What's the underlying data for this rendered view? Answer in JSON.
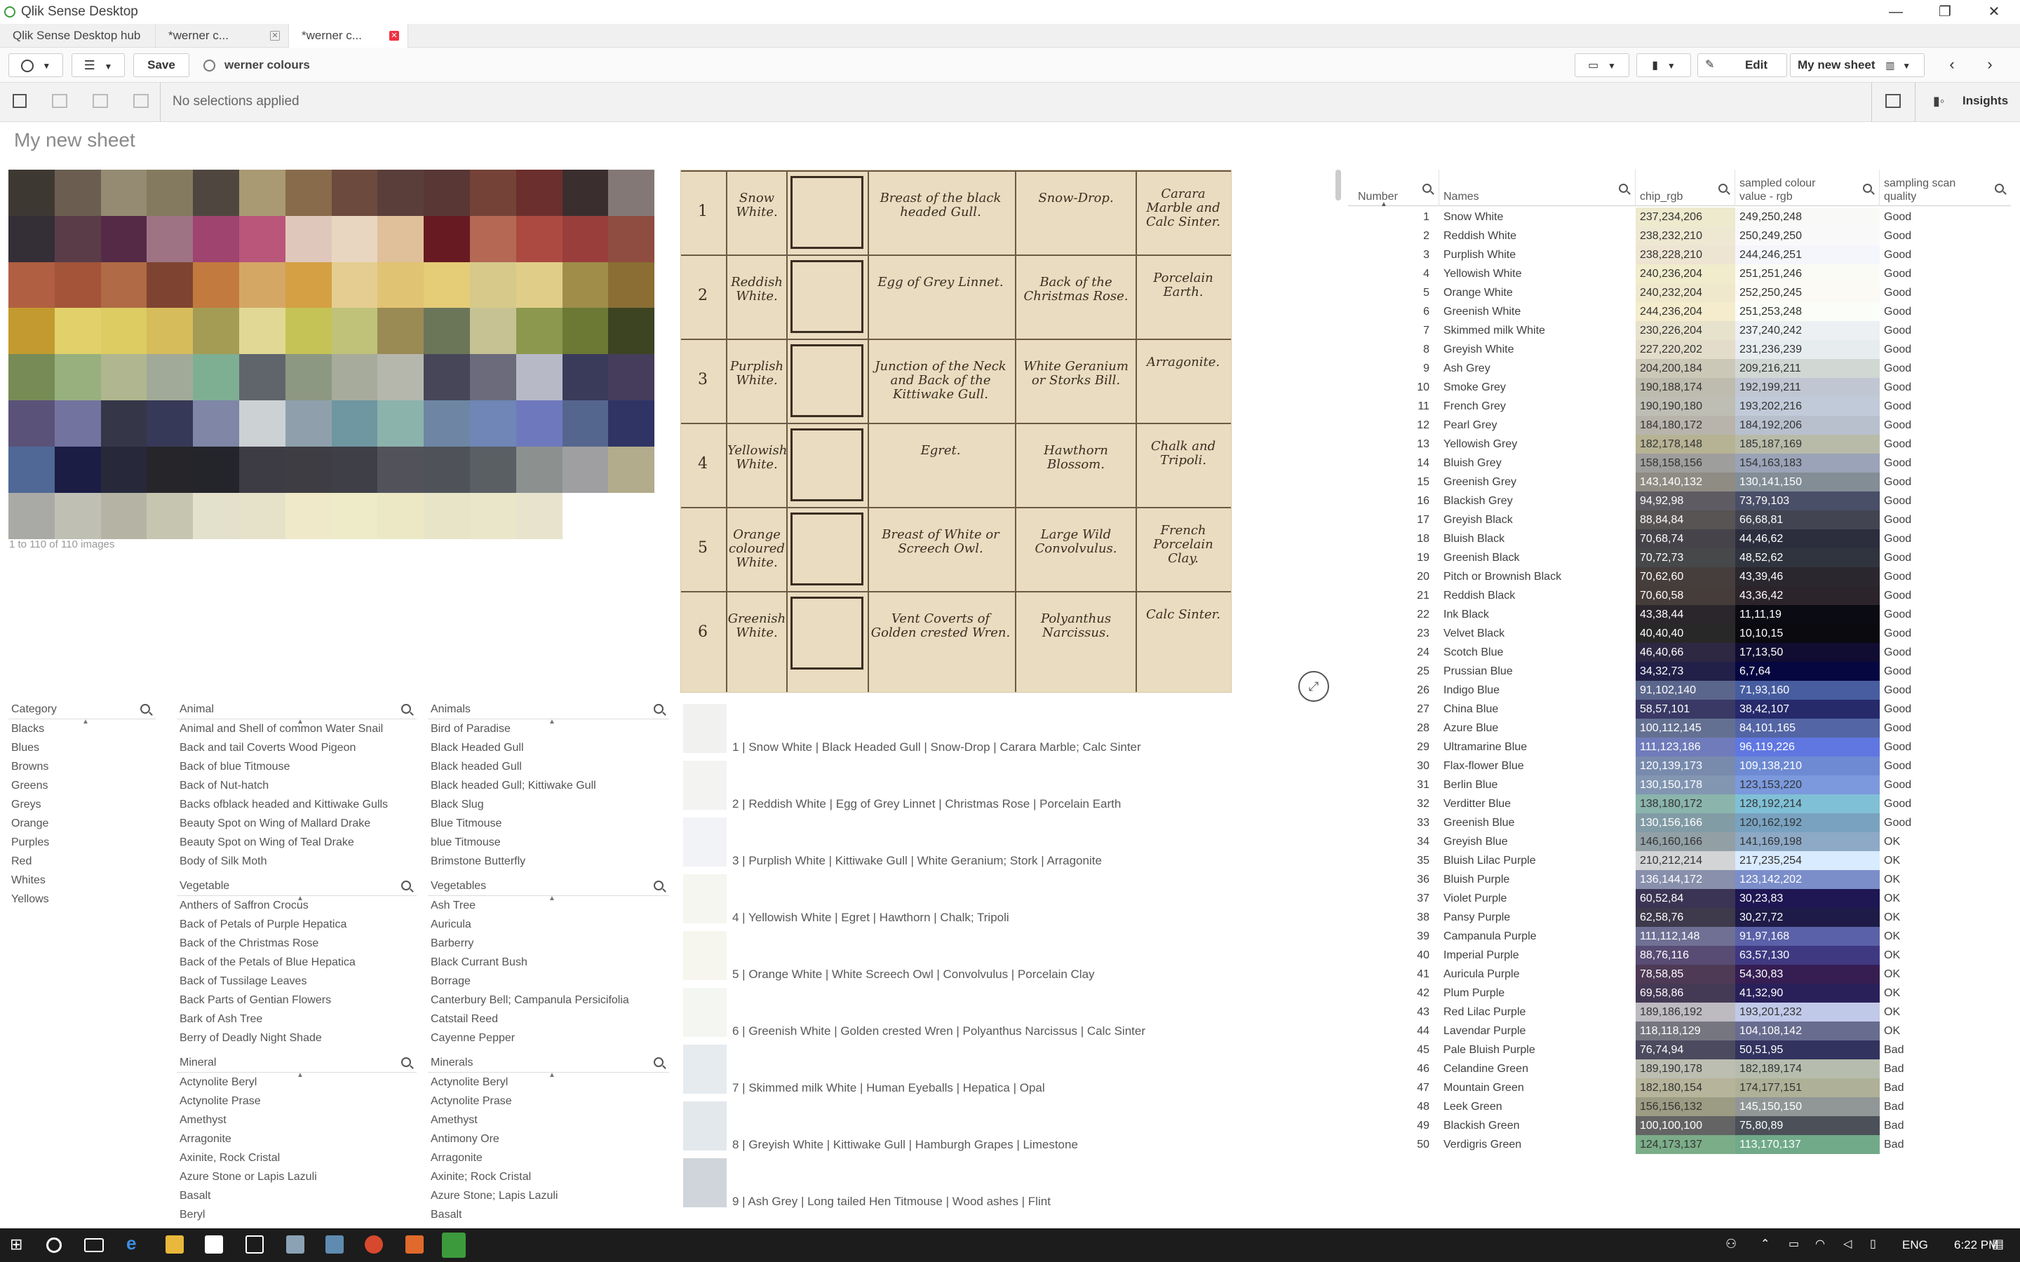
{
  "titlebar": {
    "title": "Qlik Sense Desktop",
    "minimize": "—",
    "maximize": "❐",
    "close": "✕"
  },
  "tabs": [
    {
      "label": "Qlik Sense Desktop hub",
      "close": ""
    },
    {
      "label": "*werner c...",
      "close": "✕"
    },
    {
      "label": "*werner c...",
      "close": "✕"
    }
  ],
  "toolbar": {
    "save_label": "Save",
    "app_name": "werner colours",
    "edit_label": "Edit",
    "sheet_label": "My new sheet"
  },
  "selection": {
    "status": "No selections applied",
    "insights_label": "Insights"
  },
  "sheet": {
    "title": "My new sheet",
    "image_count": "1 to 110 of 110 images"
  },
  "chip_colors": [
    "#3e3833",
    "#6b5e50",
    "#958a72",
    "#847a60",
    "#4f473f",
    "#a99a73",
    "#876b4b",
    "#6d4a3e",
    "#5a3e3a",
    "#583734",
    "#754238",
    "#6b2f2d",
    "#3b2e2e",
    "#847876",
    "#342e36",
    "#5a3c49",
    "#552a46",
    "#9e7384",
    "#9e446e",
    "#b9567a",
    "#e0c7bc",
    "#e9d6c0",
    "#e0c09a",
    "#681a22",
    "#b56854",
    "#ac4a42",
    "#9a3e3c",
    "#8f4c40",
    "#b15f42",
    "#a35439",
    "#b06a45",
    "#7e4431",
    "#c27a3f",
    "#d5a764",
    "#d4a043",
    "#e5cd91",
    "#e1c374",
    "#e5cc76",
    "#d6c98a",
    "#e0ce88",
    "#a08d4a",
    "#8b6e34",
    "#c39a2f",
    "#e2d06b",
    "#dccc62",
    "#d7bc5c",
    "#a49c54",
    "#e1d896",
    "#c5c356",
    "#bfc278",
    "#9a8a54",
    "#6b7659",
    "#c6c293",
    "#8c984e",
    "#6b7935",
    "#3c4422",
    "#768b56",
    "#97b07e",
    "#b0b68f",
    "#a1aa98",
    "#7faf93",
    "#60656b",
    "#8d9883",
    "#a7ab9b",
    "#b5b7ad",
    "#474658",
    "#6b6b7c",
    "#b8b9c7",
    "#3a3b5a",
    "#463d5c",
    "#5b5279",
    "#7373a0",
    "#353749",
    "#373958",
    "#7f86a6",
    "#ccd1d4",
    "#8fa0ac",
    "#6f97a1",
    "#8bb3ac",
    "#6e86a4",
    "#6f86b6",
    "#6e79bd",
    "#55668e",
    "#2f3465",
    "#4f6895",
    "#1b1d45",
    "#27283a",
    "#26262a",
    "#24252b",
    "#3d3c45",
    "#3e3d43",
    "#3f4047",
    "#52535a",
    "#4f5258",
    "#5a5f64",
    "#8c918f",
    "#9f9fa1",
    "#b2ab8c",
    "#a9aaa5",
    "#bfbfb4",
    "#b5b4a4",
    "#c6c5b0",
    "#e3e0cc",
    "#e6e1c9",
    "#efe9c9",
    "#eeebc9",
    "#ece7c5",
    "#e8e4c8",
    "#e9e6ca",
    "#e7e3cc"
  ],
  "plate": {
    "rows": [
      {
        "num": "1",
        "name": "Snow White.",
        "animal": "Breast of the black headed Gull.",
        "vegetable": "Snow-Drop.",
        "mineral": "Carara Marble and Calc Sinter."
      },
      {
        "num": "2",
        "name": "Reddish White.",
        "animal": "Egg of Grey Linnet.",
        "vegetable": "Back of the Christmas Rose.",
        "mineral": "Porcelain Earth."
      },
      {
        "num": "3",
        "name": "Purplish White.",
        "animal": "Junction of the Neck and Back of the Kittiwake Gull.",
        "vegetable": "White Geranium or Storks Bill.",
        "mineral": "Arragonite."
      },
      {
        "num": "4",
        "name": "Yellowish White.",
        "animal": "Egret.",
        "vegetable": "Hawthorn Blossom.",
        "mineral": "Chalk and Tripoli."
      },
      {
        "num": "5",
        "name": "Orange coloured White.",
        "animal": "Breast of White or Screech Owl.",
        "vegetable": "Large Wild Convolvulus.",
        "mineral": "French Porcelain Clay."
      },
      {
        "num": "6",
        "name": "Greenish White.",
        "animal": "Vent Coverts of Golden crested Wren.",
        "vegetable": "Polyanthus Narcissus.",
        "mineral": "Calc Sinter."
      }
    ]
  },
  "filters": {
    "category": {
      "title": "Category",
      "items": [
        "Blacks",
        "Blues",
        "Browns",
        "Greens",
        "Greys",
        "Orange",
        "Purples",
        "Red",
        "Whites",
        "Yellows"
      ]
    },
    "animal": {
      "title": "Animal",
      "items": [
        "Animal and Shell of common Water Snail",
        "Back and tail Coverts Wood Pigeon",
        "Back of blue Titmouse",
        "Back of Nut-hatch",
        "Backs ofblack headed and Kittiwake Gulls",
        "Beauty Spot on Wing of Mallard Drake",
        "Beauty Spot on Wing of Teal Drake",
        "Body of Silk Moth"
      ]
    },
    "animals": {
      "title": "Animals",
      "items": [
        "Bird of Paradise",
        "Black Headed Gull",
        "Black headed Gull",
        "Black headed Gull; Kittiwake Gull",
        "Black Slug",
        "Blue Titmouse",
        "blue Titmouse",
        "Brimstone Butterfly"
      ]
    },
    "vegetable": {
      "title": "Vegetable",
      "items": [
        "Anthers of Saffron Crocus",
        "Back of Petals of Purple Hepatica",
        "Back of the Christmas Rose",
        "Back of the Petals of Blue Hepatica",
        "Back of Tussilage Leaves",
        "Back Parts of Gentian Flowers",
        "Bark of Ash Tree",
        "Berry of Deadly Night Shade"
      ]
    },
    "vegetables": {
      "title": "Vegetables",
      "items": [
        "Ash Tree",
        "Auricula",
        "Barberry",
        "Black Currant Bush",
        "Borrage",
        "Canterbury Bell; Campanula Persicifolia",
        "Catstail Reed",
        "Cayenne Pepper"
      ]
    },
    "mineral": {
      "title": "Mineral",
      "items": [
        "Actynolite Beryl",
        "Actynolite Prase",
        "Amethyst",
        "Arragonite",
        "Axinite, Rock Cristal",
        "Azure Stone or Lapis Lazuli",
        "Basalt",
        "Beryl"
      ]
    },
    "minerals": {
      "title": "Minerals",
      "items": [
        "Actynolite Beryl",
        "Actynolite Prase",
        "Amethyst",
        "Antimony Ore",
        "Arragonite",
        "Axinite; Rock Cristal",
        "Azure Stone; Lapis Lazuli",
        "Basalt"
      ]
    }
  },
  "descriptions": [
    {
      "text": "1 | Snow White | Black Headed Gull | Snow-Drop | Carara Marble; Calc Sinter",
      "color": "#f1f2f0"
    },
    {
      "text": "2 | Reddish White | Egg of Grey Linnet | Christmas Rose | Porcelain Earth",
      "color": "#f3f3f1"
    },
    {
      "text": "3 | Purplish White | Kittiwake Gull | White Geranium; Stork | Arragonite",
      "color": "#f2f3f7"
    },
    {
      "text": "4 | Yellowish White | Egret | Hawthorn | Chalk; Tripoli",
      "color": "#f6f6f0"
    },
    {
      "text": "5 | Orange White | White Screech Owl | Convolvulus | Porcelain Clay",
      "color": "#f6f6ef"
    },
    {
      "text": "6 | Greenish White | Golden crested Wren | Polyanthus Narcissus | Calc Sinter",
      "color": "#f4f6f1"
    },
    {
      "text": "7 | Skimmed milk White | Human Eyeballs | Hepatica | Opal",
      "color": "#e6ebef"
    },
    {
      "text": "8 | Greyish White | Kittiwake Gull | Hamburgh Grapes | Limestone",
      "color": "#e3e8ec"
    },
    {
      "text": "9 | Ash Grey | Long tailed Hen Titmouse | Wood ashes | Flint",
      "color": "#cfd5db"
    }
  ],
  "table": {
    "headers": {
      "number": "Number",
      "names": "Names",
      "chip": "chip_rgb",
      "sampled": "sampled colour value - rgb",
      "quality": "sampling scan quality"
    },
    "rows": [
      [
        "1",
        "Snow White",
        "237,234,206",
        "249,250,248",
        "Good"
      ],
      [
        "2",
        "Reddish White",
        "238,232,210",
        "250,249,250",
        "Good"
      ],
      [
        "3",
        "Purplish White",
        "238,228,210",
        "244,246,251",
        "Good"
      ],
      [
        "4",
        "Yellowish White",
        "240,236,204",
        "251,251,246",
        "Good"
      ],
      [
        "5",
        "Orange White",
        "240,232,204",
        "252,250,245",
        "Good"
      ],
      [
        "6",
        "Greenish White",
        "244,236,204",
        "251,253,248",
        "Good"
      ],
      [
        "7",
        "Skimmed milk White",
        "230,226,204",
        "237,240,242",
        "Good"
      ],
      [
        "8",
        "Greyish White",
        "227,220,202",
        "231,236,239",
        "Good"
      ],
      [
        "9",
        "Ash Grey",
        "204,200,184",
        "209,216,211",
        "Good"
      ],
      [
        "10",
        "Smoke Grey",
        "190,188,174",
        "192,199,211",
        "Good"
      ],
      [
        "11",
        "French Grey",
        "190,190,180",
        "193,202,216",
        "Good"
      ],
      [
        "12",
        "Pearl Grey",
        "184,180,172",
        "184,192,206",
        "Good"
      ],
      [
        "13",
        "Yellowish Grey",
        "182,178,148",
        "185,187,169",
        "Good"
      ],
      [
        "14",
        "Bluish Grey",
        "158,158,156",
        "154,163,183",
        "Good"
      ],
      [
        "15",
        "Greenish Grey",
        "143,140,132",
        "130,141,150",
        "Good"
      ],
      [
        "16",
        "Blackish Grey",
        "94,92,98",
        "73,79,103",
        "Good"
      ],
      [
        "17",
        "Greyish Black",
        "88,84,84",
        "66,68,81",
        "Good"
      ],
      [
        "18",
        "Bluish Black",
        "70,68,74",
        "44,46,62",
        "Good"
      ],
      [
        "19",
        "Greenish Black",
        "70,72,73",
        "48,52,62",
        "Good"
      ],
      [
        "20",
        "Pitch or Brownish Black",
        "70,62,60",
        "43,39,46",
        "Good"
      ],
      [
        "21",
        "Reddish Black",
        "70,60,58",
        "43,36,42",
        "Good"
      ],
      [
        "22",
        "Ink Black",
        "43,38,44",
        "11,11,19",
        "Good"
      ],
      [
        "23",
        "Velvet Black",
        "40,40,40",
        "10,10,15",
        "Good"
      ],
      [
        "24",
        "Scotch Blue",
        "46,40,66",
        "17,13,50",
        "Good"
      ],
      [
        "25",
        "Prussian Blue",
        "34,32,73",
        "6,7,64",
        "Good"
      ],
      [
        "26",
        "Indigo Blue",
        "91,102,140",
        "71,93,160",
        "Good"
      ],
      [
        "27",
        "China Blue",
        "58,57,101",
        "38,42,107",
        "Good"
      ],
      [
        "28",
        "Azure Blue",
        "100,112,145",
        "84,101,165",
        "Good"
      ],
      [
        "29",
        "Ultramarine Blue",
        "111,123,186",
        "96,119,226",
        "Good"
      ],
      [
        "30",
        "Flax-flower Blue",
        "120,139,173",
        "109,138,210",
        "Good"
      ],
      [
        "31",
        "Berlin Blue",
        "130,150,178",
        "123,153,220",
        "Good"
      ],
      [
        "32",
        "Verditter Blue",
        "138,180,172",
        "128,192,214",
        "Good"
      ],
      [
        "33",
        "Greenish Blue",
        "130,156,166",
        "120,162,192",
        "Good"
      ],
      [
        "34",
        "Greyish Blue",
        "146,160,166",
        "141,169,198",
        "OK"
      ],
      [
        "35",
        "Bluish Lilac Purple",
        "210,212,214",
        "217,235,254",
        "OK"
      ],
      [
        "36",
        "Bluish Purple",
        "136,144,172",
        "123,142,202",
        "OK"
      ],
      [
        "37",
        "Violet Purple",
        "60,52,84",
        "30,23,83",
        "OK"
      ],
      [
        "38",
        "Pansy Purple",
        "62,58,76",
        "30,27,72",
        "OK"
      ],
      [
        "39",
        "Campanula Purple",
        "111,112,148",
        "91,97,168",
        "OK"
      ],
      [
        "40",
        "Imperial Purple",
        "88,76,116",
        "63,57,130",
        "OK"
      ],
      [
        "41",
        "Auricula Purple",
        "78,58,85",
        "54,30,83",
        "OK"
      ],
      [
        "42",
        "Plum Purple",
        "69,58,86",
        "41,32,90",
        "OK"
      ],
      [
        "43",
        "Red Lilac Purple",
        "189,186,192",
        "193,201,232",
        "OK"
      ],
      [
        "44",
        "Lavendar Purple",
        "118,118,129",
        "104,108,142",
        "OK"
      ],
      [
        "45",
        "Pale Bluish Purple",
        "76,74,94",
        "50,51,95",
        "Bad"
      ],
      [
        "46",
        "Celandine Green",
        "189,190,178",
        "182,189,174",
        "Bad"
      ],
      [
        "47",
        "Mountain Green",
        "182,180,154",
        "174,177,151",
        "Bad"
      ],
      [
        "48",
        "Leek Green",
        "156,156,132",
        "145,150,150",
        "Bad"
      ],
      [
        "49",
        "Blackish Green",
        "100,100,100",
        "75,80,89",
        "Bad"
      ],
      [
        "50",
        "Verdigris Green",
        "124,173,137",
        "113,170,137",
        "Bad"
      ]
    ]
  },
  "taskbar": {
    "lang": "ENG",
    "time": "6:22 PM"
  }
}
